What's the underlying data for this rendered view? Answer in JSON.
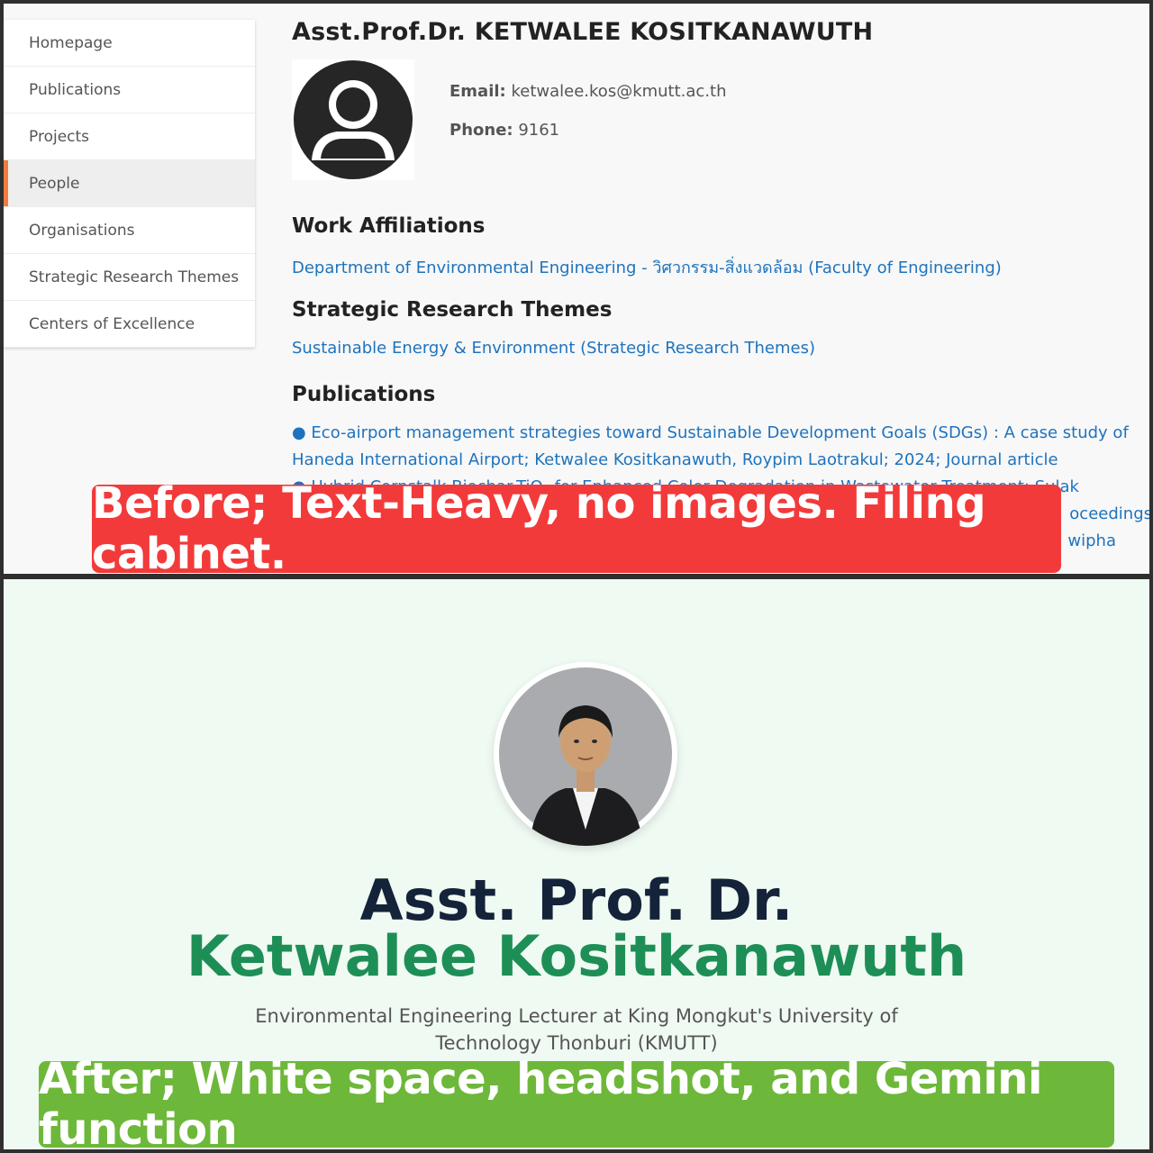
{
  "before": {
    "sidebar": {
      "items": [
        {
          "label": "Homepage"
        },
        {
          "label": "Publications"
        },
        {
          "label": "Projects"
        },
        {
          "label": "People"
        },
        {
          "label": "Organisations"
        },
        {
          "label": "Strategic Research Themes"
        },
        {
          "label": "Centers of Excellence"
        }
      ],
      "active_index": 3,
      "accent_color": "#f07b3c"
    },
    "profile": {
      "name": "Asst.Prof.Dr. KETWALEE KOSITKANAWUTH",
      "avatar_icon": "user-placeholder-icon",
      "email_label": "Email:",
      "email": "ketwalee.kos@kmutt.ac.th",
      "phone_label": "Phone:",
      "phone": "9161"
    },
    "work_affiliations": {
      "heading": "Work Affiliations",
      "link": "Department of Environmental Engineering - วิศวกรรม-สิ่งแวดล้อม (Faculty of Engineering)"
    },
    "strategic_themes": {
      "heading": "Strategic Research Themes",
      "link": "Sustainable Energy & Environment (Strategic Research Themes)"
    },
    "publications": {
      "heading": "Publications",
      "items": [
        "● Eco-airport management strategies toward Sustainable Development Goals (SDGs) : A case study of Haneda International Airport; Ketwalee Kositkanawuth, Roypim Laotrakul; 2024; Journal article",
        "● Hybrid Cornstalk Biochar-TiO₂ for Enhanced Color Degradation in Wastewater Treatment; Sulak",
        "oceedings",
        "wipha"
      ]
    },
    "banner": "Before; Text-Heavy, no images. Filing cabinet.",
    "banner_color": "#f23a3a"
  },
  "after": {
    "headshot_icon": "headshot-photo",
    "title_line1": "Asst. Prof. Dr.",
    "title_line2": "Ketwalee Kositkanawuth",
    "subtitle": "Environmental Engineering Lecturer at King Mongkut's University of Technology Thonburi (KMUTT)",
    "banner": "After; White space, headshot, and Gemini function",
    "banner_color": "#6db83a",
    "accent_color": "#1e8e57"
  }
}
